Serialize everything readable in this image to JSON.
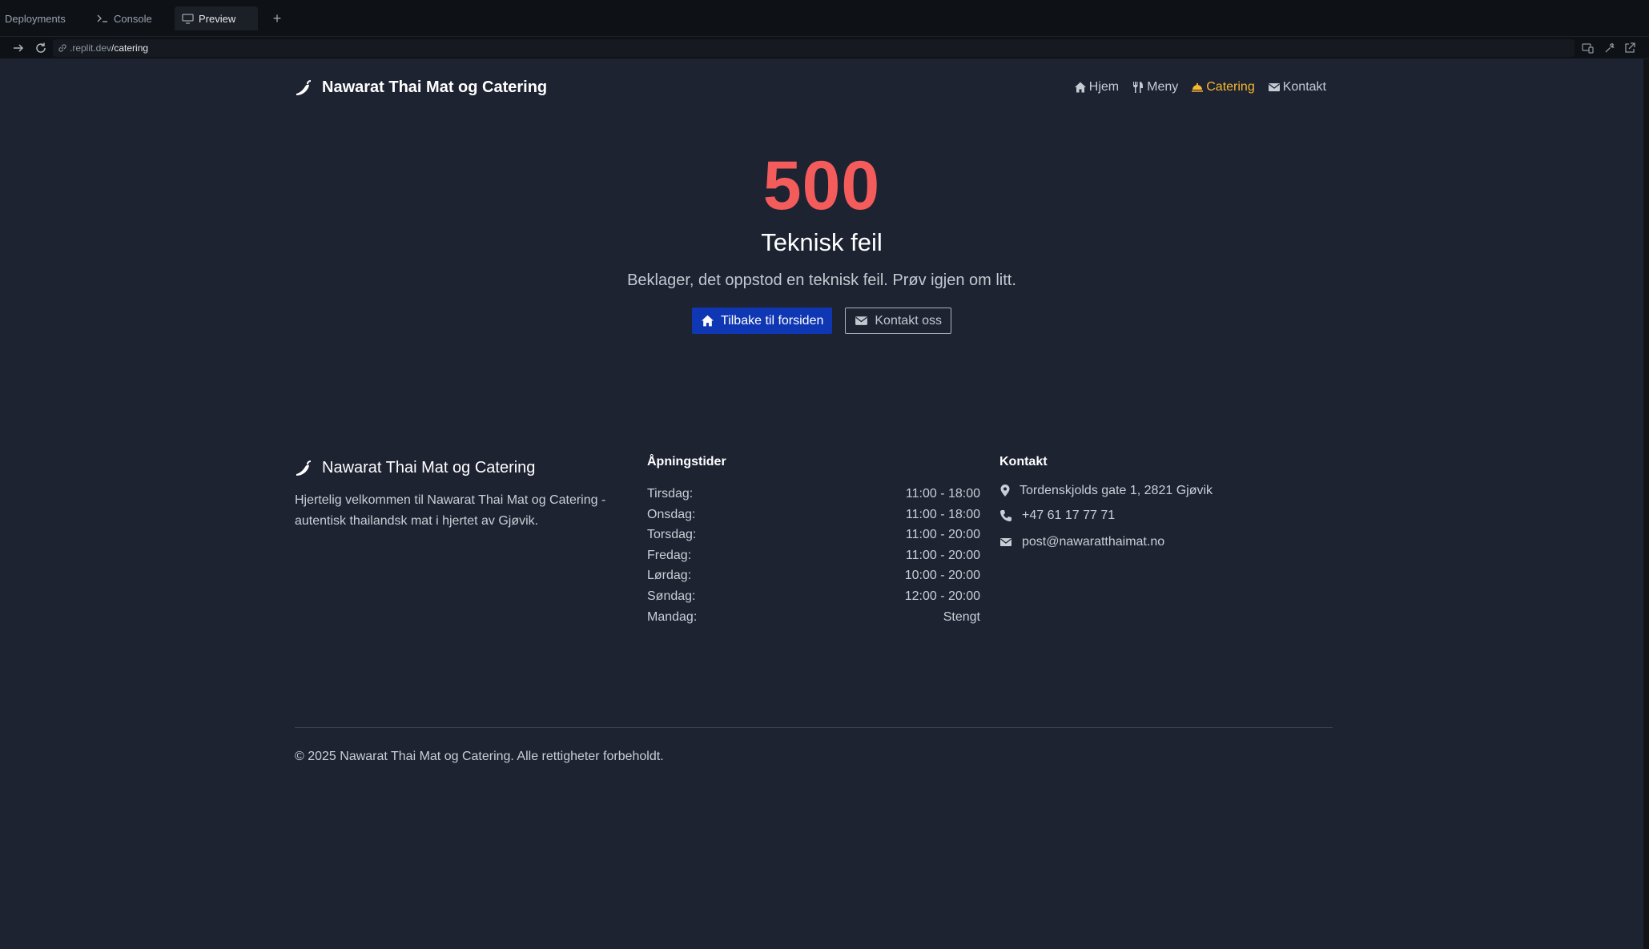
{
  "ide": {
    "tabs": [
      {
        "label": "Deployments"
      },
      {
        "label": "Console"
      },
      {
        "label": "Preview"
      }
    ],
    "add_tab": "+",
    "url": {
      "host": ".replit.dev",
      "path": "/catering"
    }
  },
  "site": {
    "brand": "Nawarat Thai Mat og Catering",
    "nav": [
      {
        "label": "Hjem",
        "icon": "home-icon"
      },
      {
        "label": "Meny",
        "icon": "utensils-icon"
      },
      {
        "label": "Catering",
        "icon": "food-tray-icon",
        "active": true
      },
      {
        "label": "Kontakt",
        "icon": "envelope-icon"
      }
    ],
    "accent_color": "#f5b82e"
  },
  "error": {
    "code": "500",
    "title": "Teknisk feil",
    "message": "Beklager, det oppstod en teknisk feil. Prøv igjen om litt.",
    "primary_button": "Tilbake til forsiden",
    "secondary_button": "Kontakt oss",
    "code_color": "#f45b5b"
  },
  "footer": {
    "brand": "Nawarat Thai Mat og Catering",
    "description": "Hjertelig velkommen til Nawarat Thai Mat og Catering - autentisk thailandsk mat i hjertet av Gjøvik.",
    "hours_title": "Åpningstider",
    "hours": [
      {
        "day": "Tirsdag:",
        "time": "11:00 - 18:00"
      },
      {
        "day": "Onsdag:",
        "time": "11:00 - 18:00"
      },
      {
        "day": "Torsdag:",
        "time": "11:00 - 20:00"
      },
      {
        "day": "Fredag:",
        "time": "11:00 - 20:00"
      },
      {
        "day": "Lørdag:",
        "time": "10:00 - 20:00"
      },
      {
        "day": "Søndag:",
        "time": "12:00 - 20:00"
      },
      {
        "day": "Mandag:",
        "time": "Stengt"
      }
    ],
    "contact_title": "Kontakt",
    "address": "Tordenskjolds gate 1, 2821 Gjøvik",
    "phone": "+47 61 17 77 71",
    "email": "post@nawaratthaimat.no",
    "copyright": "© 2025 Nawarat Thai Mat og Catering. Alle rettigheter forbeholdt."
  }
}
